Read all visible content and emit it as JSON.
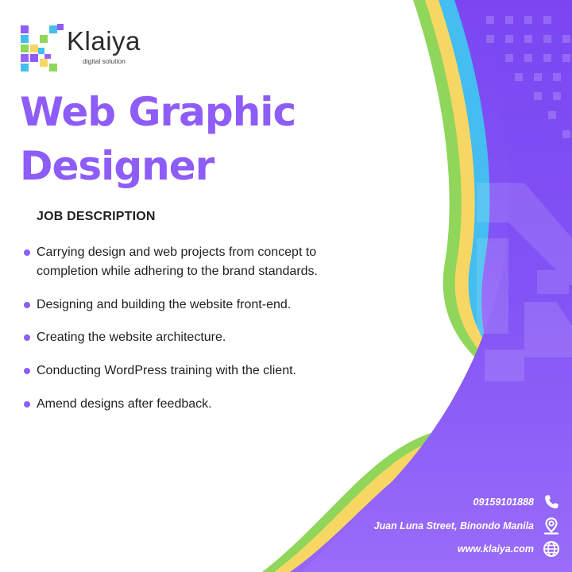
{
  "brand": {
    "name": "Klaiya",
    "tagline": "digital solution"
  },
  "title": {
    "line1": "Web Graphic",
    "line2": "Designer"
  },
  "job_description": {
    "heading": "JOB DESCRIPTION",
    "items": [
      "Carrying design and web projects from concept to completion while adhering to the brand standards.",
      "Designing and building the website front-end.",
      "Creating the website architecture.",
      "Conducting WordPress training with the client.",
      "Amend designs after feedback."
    ]
  },
  "contacts": {
    "phone": "09159101888",
    "address": "Juan Luna Street, Binondo Manila",
    "website": "www.klaiya.com",
    "phone_icon": "phone-icon",
    "address_icon": "location-pin-icon",
    "website_icon": "globe-icon"
  },
  "colors": {
    "purple": "#8e5cf7",
    "violet_band": "#7c4dff",
    "green": "#8fd65a",
    "yellow": "#f7d764",
    "blue": "#44bdf0"
  }
}
